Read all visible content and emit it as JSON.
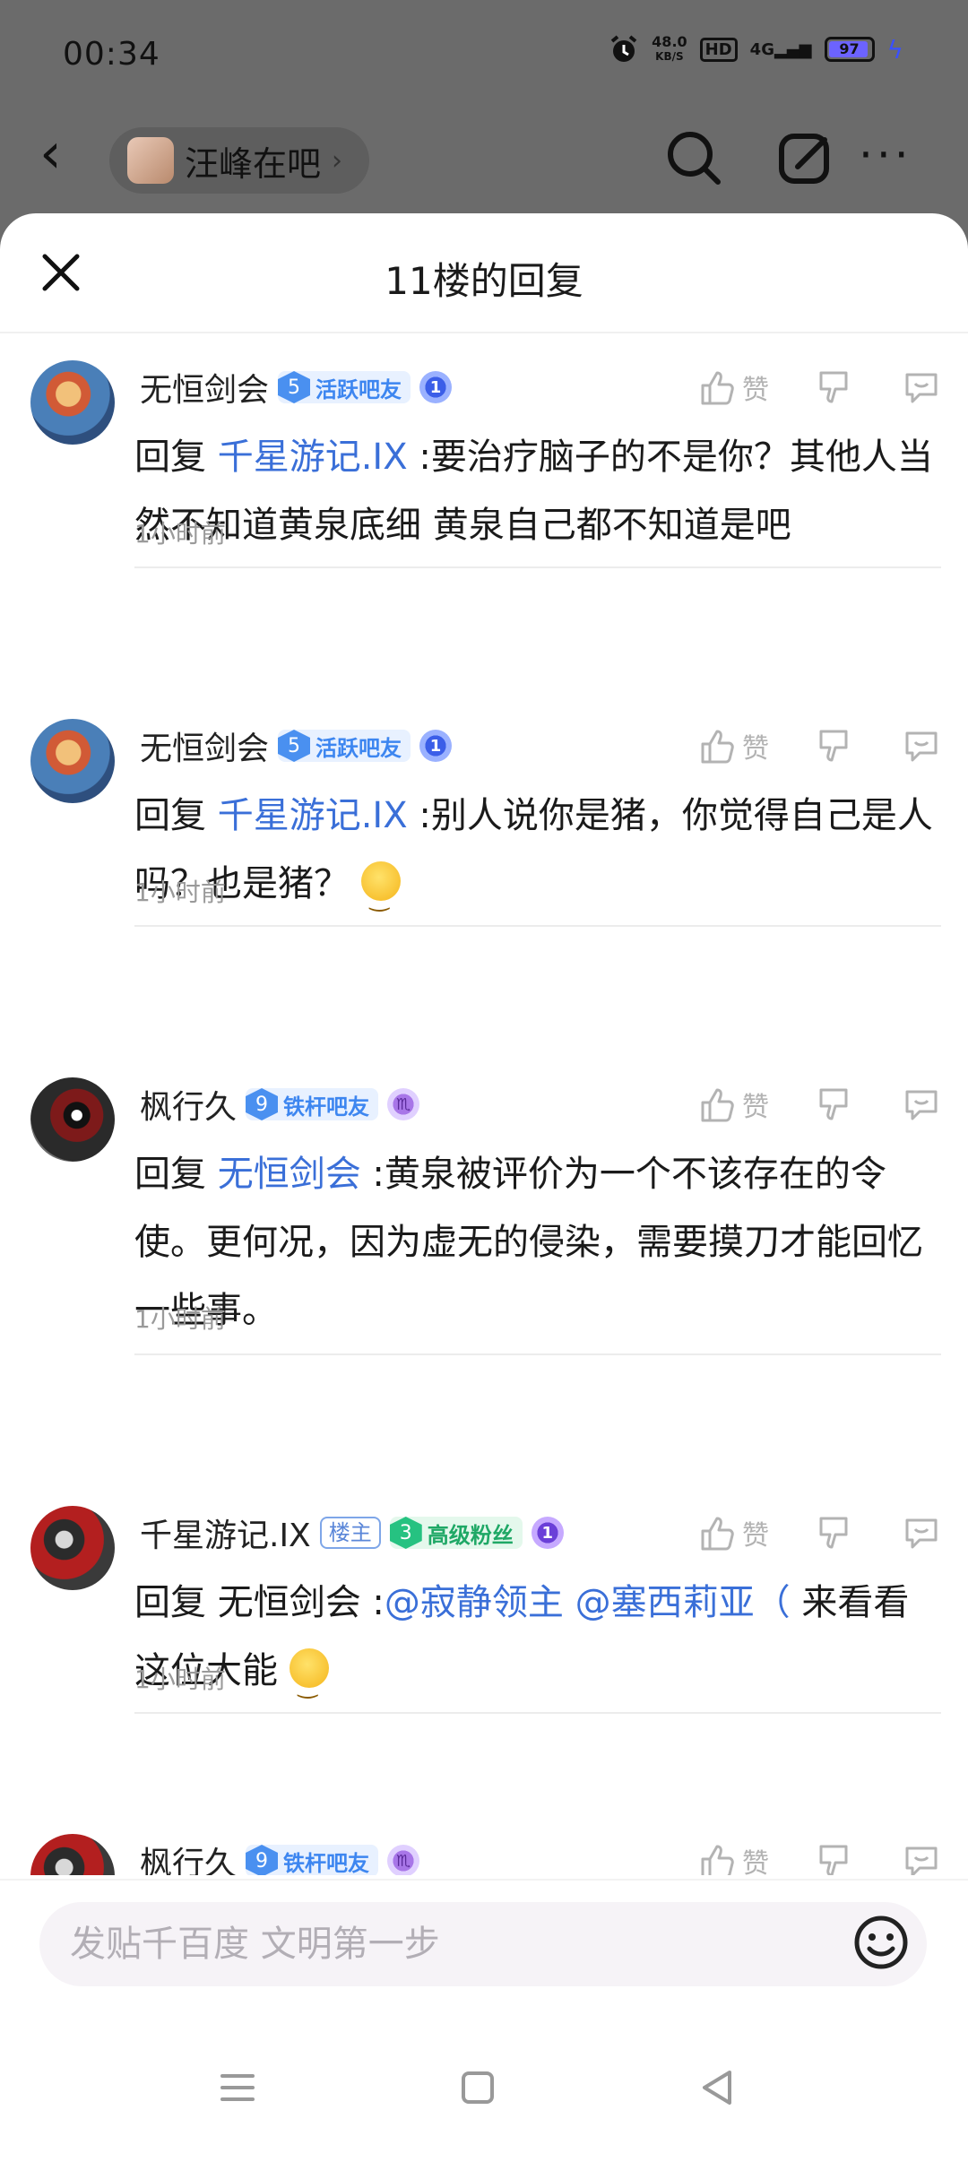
{
  "status_bar": {
    "time": "00:34",
    "net_speed": "48.0",
    "net_unit": "KB/S",
    "hd_label": "HD",
    "network": "4G",
    "battery": "97"
  },
  "top_nav": {
    "forum_name": "汪峰在吧"
  },
  "sheet": {
    "title": "11楼的回复"
  },
  "reply_prefix": "回复",
  "like_label": "赞",
  "replies": [
    {
      "username": "无恒剑会",
      "level": "5",
      "badge": "活跃吧友",
      "badge_color": "blue",
      "medal": "1",
      "reply_to": "千星游记.IX",
      "text": " :要治疗脑子的不是你？其他人当然不知道黄泉底细 黄泉自己都不知道是吧",
      "time": "1小时前"
    },
    {
      "username": "无恒剑会",
      "level": "5",
      "badge": "活跃吧友",
      "badge_color": "blue",
      "medal": "1",
      "reply_to": "千星游记.IX",
      "text": " :别人说你是猪，你觉得自己是人吗？也是猪？",
      "has_emoji": true,
      "time": "1小时前"
    },
    {
      "username": "枫行久",
      "level": "9",
      "badge": "铁杆吧友",
      "badge_color": "blue",
      "reply_to": "无恒剑会",
      "text": " :黄泉被评价为一个不该存在的令使。更何况，因为虚无的侵染，需要摸刀才能回忆一些事。",
      "time": "1小时前"
    },
    {
      "username": "千星游记.IX",
      "owner_tag": "楼主",
      "level": "3",
      "badge": "高级粉丝",
      "badge_color": "green",
      "medal": "1",
      "reply_to_plain": "无恒剑会 :",
      "mention_1": "@寂静领主",
      "mention_2": "@塞西莉亚（",
      "text_tail": " 来看看这位大能",
      "has_emoji": true,
      "time": "1小时前"
    },
    {
      "username": "枫行久",
      "level": "9",
      "badge": "铁杆吧友",
      "badge_color": "blue"
    }
  ],
  "composer": {
    "placeholder": "发贴千百度 文明第一步"
  },
  "colors": {
    "link": "#3a6fd8",
    "badge_blue": "#3d86f0",
    "badge_green": "#1fa866",
    "overlay": "#6b6b6b"
  },
  "icons": [
    "back-icon",
    "search-icon",
    "edit-icon",
    "more-icon",
    "close-icon",
    "thumb-up-icon",
    "thumb-down-icon",
    "comment-icon",
    "emoji-icon",
    "menu-icon",
    "home-icon",
    "back-triangle-icon"
  ]
}
